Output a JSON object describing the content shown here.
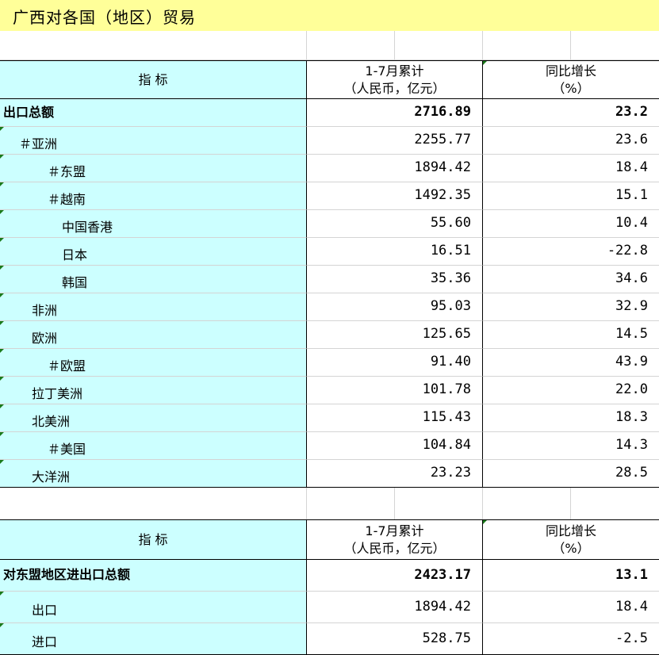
{
  "title": "广西对各国（地区）贸易",
  "header1": {
    "indicator": "指    标",
    "value_line1": "1-7月累计",
    "value_line2": "（人民币，亿元）",
    "growth_line1": "同比增长",
    "growth_line2": "（%）"
  },
  "export_table": [
    {
      "label": "出口总额",
      "value": "2716.89",
      "growth": "23.2",
      "bold": true,
      "indent": 0
    },
    {
      "label": "＃亚洲",
      "value": "2255.77",
      "growth": "23.6",
      "indent": 1
    },
    {
      "label": "＃东盟",
      "value": "1894.42",
      "growth": "18.4",
      "indent": 3
    },
    {
      "label": "＃越南",
      "value": "1492.35",
      "growth": "15.1",
      "indent": 3
    },
    {
      "label": "中国香港",
      "value": "55.60",
      "growth": "10.4",
      "indent": 4
    },
    {
      "label": "日本",
      "value": "16.51",
      "growth": "-22.8",
      "indent": 4
    },
    {
      "label": "韩国",
      "value": "35.36",
      "growth": "34.6",
      "indent": 4
    },
    {
      "label": "非洲",
      "value": "95.03",
      "growth": "32.9",
      "indent": 2
    },
    {
      "label": "欧洲",
      "value": "125.65",
      "growth": "14.5",
      "indent": 2
    },
    {
      "label": "＃欧盟",
      "value": "91.40",
      "growth": "43.9",
      "indent": 3
    },
    {
      "label": "拉丁美洲",
      "value": "101.78",
      "growth": "22.0",
      "indent": 2
    },
    {
      "label": "北美洲",
      "value": "115.43",
      "growth": "18.3",
      "indent": 2
    },
    {
      "label": "＃美国",
      "value": "104.84",
      "growth": "14.3",
      "indent": 3
    },
    {
      "label": "大洋洲",
      "value": "23.23",
      "growth": "28.5",
      "indent": 2
    }
  ],
  "header2": {
    "indicator": "指    标",
    "value_line1": "1-7月累计",
    "value_line2": "（人民币，亿元）",
    "growth_line1": "同比增长",
    "growth_line2": "（%）"
  },
  "asean_table": [
    {
      "label": "对东盟地区进出口总额",
      "value": "2423.17",
      "growth": "13.1",
      "bold": true,
      "indent": 0
    },
    {
      "label": "出口",
      "value": "1894.42",
      "growth": "18.4",
      "indent": 2
    },
    {
      "label": "进口",
      "value": "528.75",
      "growth": "-2.5",
      "indent": 2
    }
  ],
  "colors": {
    "title_bg": "#ffff99",
    "label_bg": "#ccffff",
    "header_bg": "#ccffff"
  }
}
